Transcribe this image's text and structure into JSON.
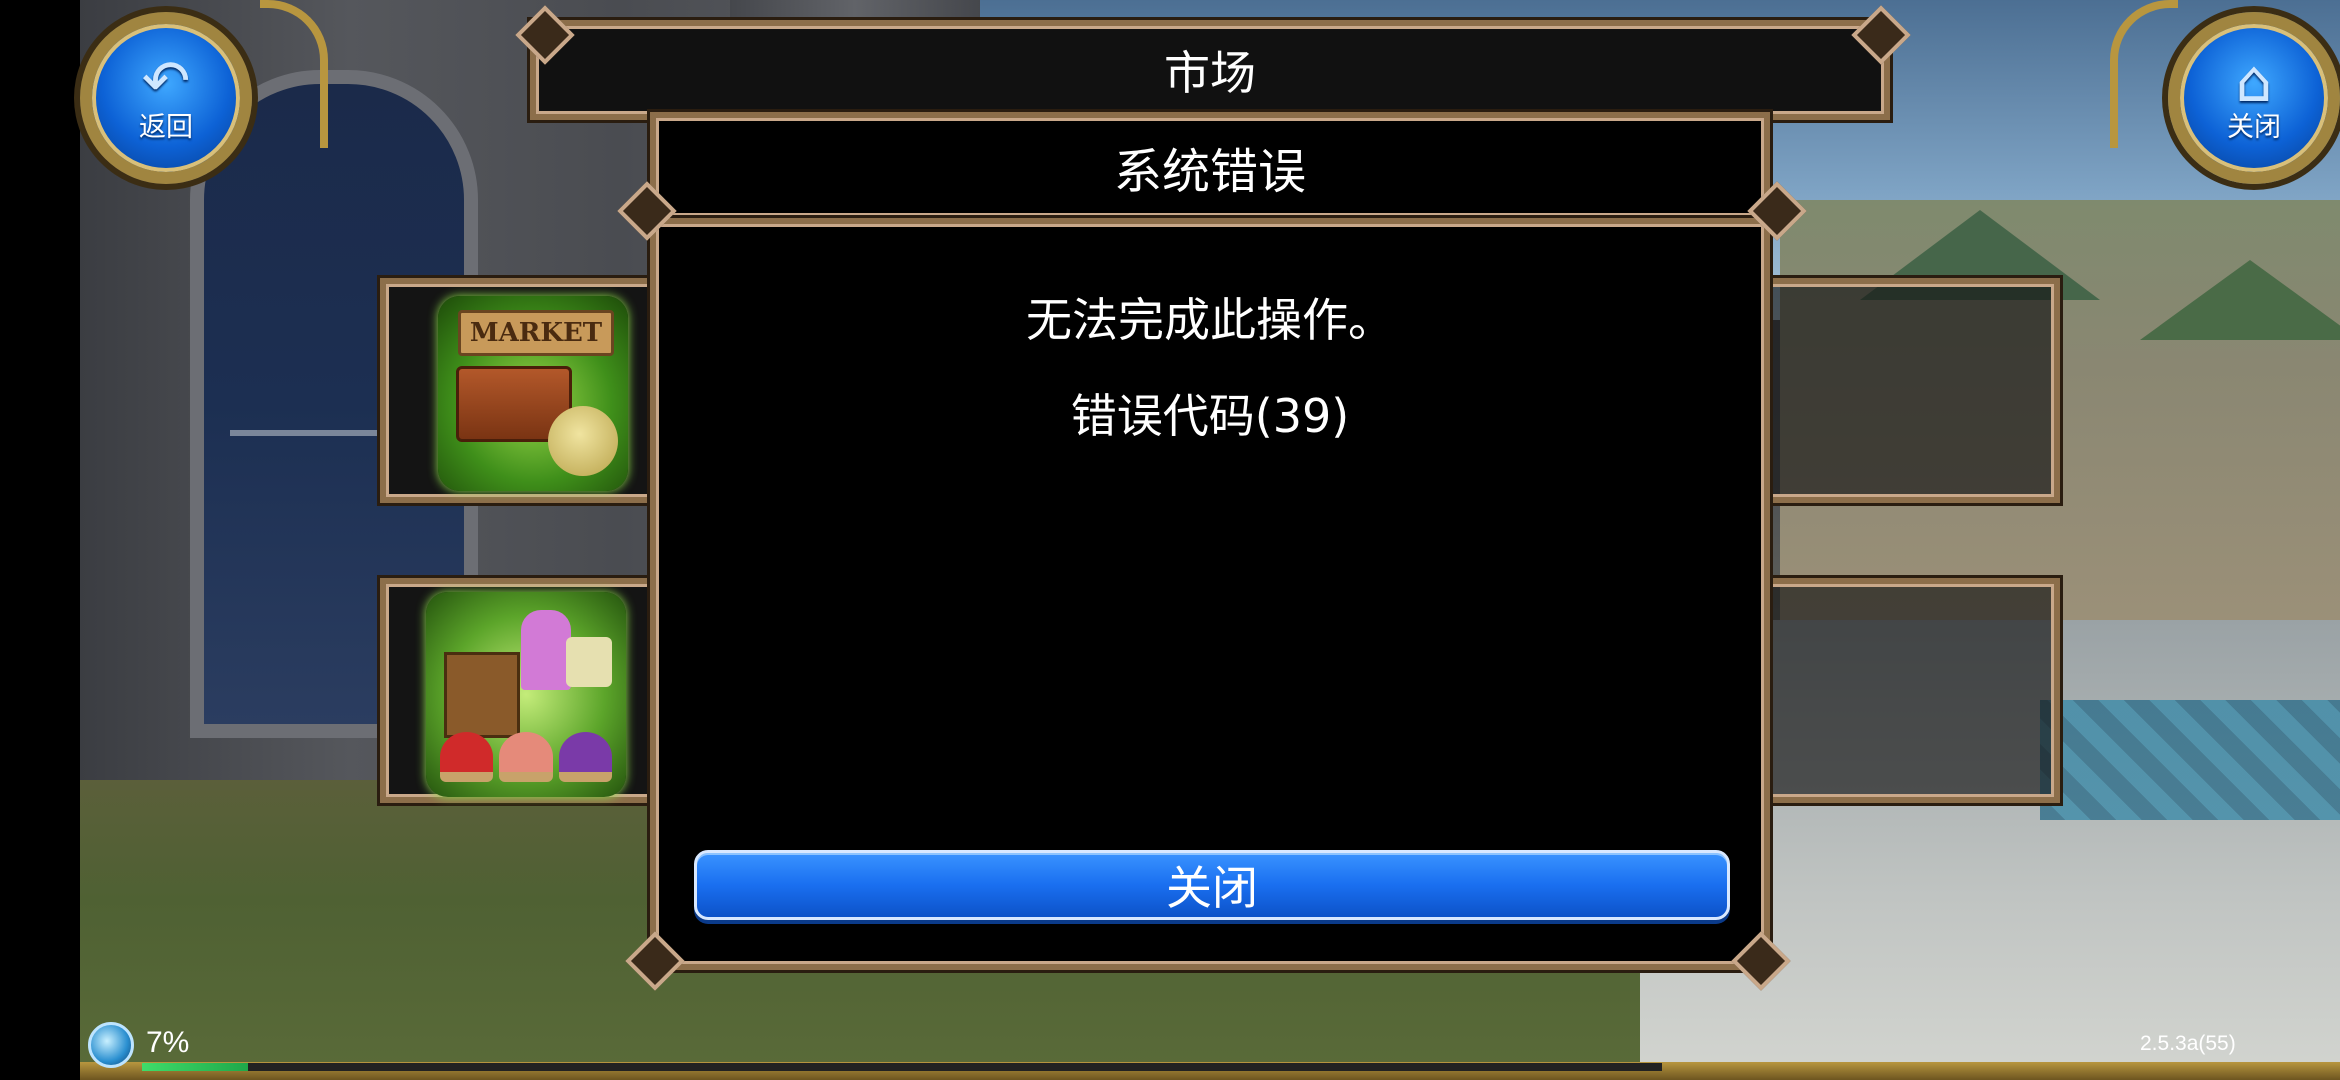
{
  "header": {
    "title": "市场",
    "back_button": {
      "label": "返回",
      "icon": "return-arrow-icon"
    },
    "close_button": {
      "label": "关闭",
      "icon": "home-icon"
    }
  },
  "market_cards": [
    {
      "icon": "market-sell-icon",
      "sign_text": "MARKET"
    },
    {
      "icon": "market-stall-icon"
    }
  ],
  "dialog": {
    "title": "系统错误",
    "message": "无法完成此操作。",
    "error_code": "错误代码(39)",
    "close_label": "关闭"
  },
  "status": {
    "progress_percent": 7,
    "progress_text": "7%",
    "version": "2.5.3a(55)"
  },
  "colors": {
    "accent_blue": "#1a6ff0",
    "frame_gold": "#8c6e4a",
    "progress_green": "#1fa84a"
  }
}
